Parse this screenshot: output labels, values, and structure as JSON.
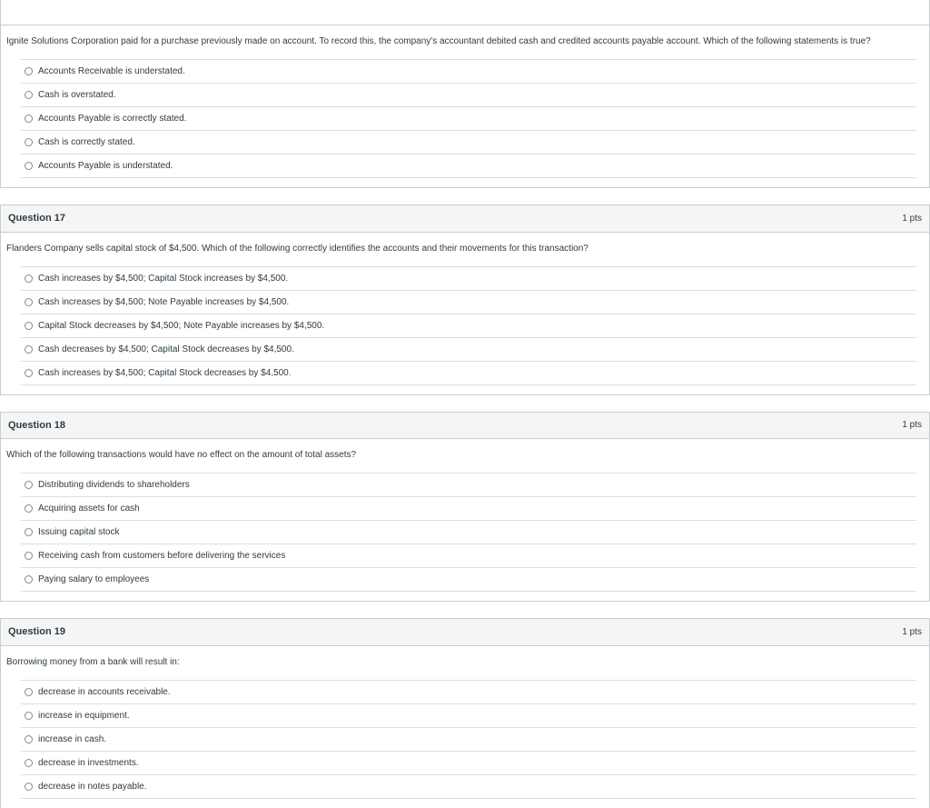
{
  "partial": {
    "prompt": "Ignite Solutions Corporation paid for a purchase previously made on account. To record this, the company's accountant debited cash and credited accounts payable account. Which of the following statements is true?",
    "answers": [
      "Accounts Receivable is understated.",
      "Cash is overstated.",
      "Accounts Payable is correctly stated.",
      "Cash is correctly stated.",
      "Accounts Payable is understated."
    ]
  },
  "q17": {
    "title": "Question 17",
    "pts": "1 pts",
    "prompt": "Flanders Company sells capital stock of $4,500. Which of the following correctly identifies the accounts and their movements for this transaction?",
    "answers": [
      "Cash increases by $4,500; Capital Stock increases by $4,500.",
      "Cash increases by $4,500; Note Payable increases by $4,500.",
      "Capital Stock decreases by $4,500; Note Payable increases by $4,500.",
      "Cash decreases by $4,500; Capital Stock decreases by $4,500.",
      "Cash increases by $4,500; Capital Stock decreases by $4,500."
    ]
  },
  "q18": {
    "title": "Question 18",
    "pts": "1 pts",
    "prompt": "Which of the following transactions would have no effect on the amount of total assets?",
    "answers": [
      "Distributing dividends to shareholders",
      "Acquiring assets for cash",
      "Issuing capital stock",
      "Receiving cash from customers before delivering the services",
      "Paying salary to employees"
    ]
  },
  "q19": {
    "title": "Question 19",
    "pts": "1 pts",
    "prompt": "Borrowing money from a bank will result in:",
    "answers": [
      "decrease in accounts receivable.",
      "increase in equipment.",
      "increase in cash.",
      "decrease in investments.",
      "decrease in notes payable."
    ]
  }
}
